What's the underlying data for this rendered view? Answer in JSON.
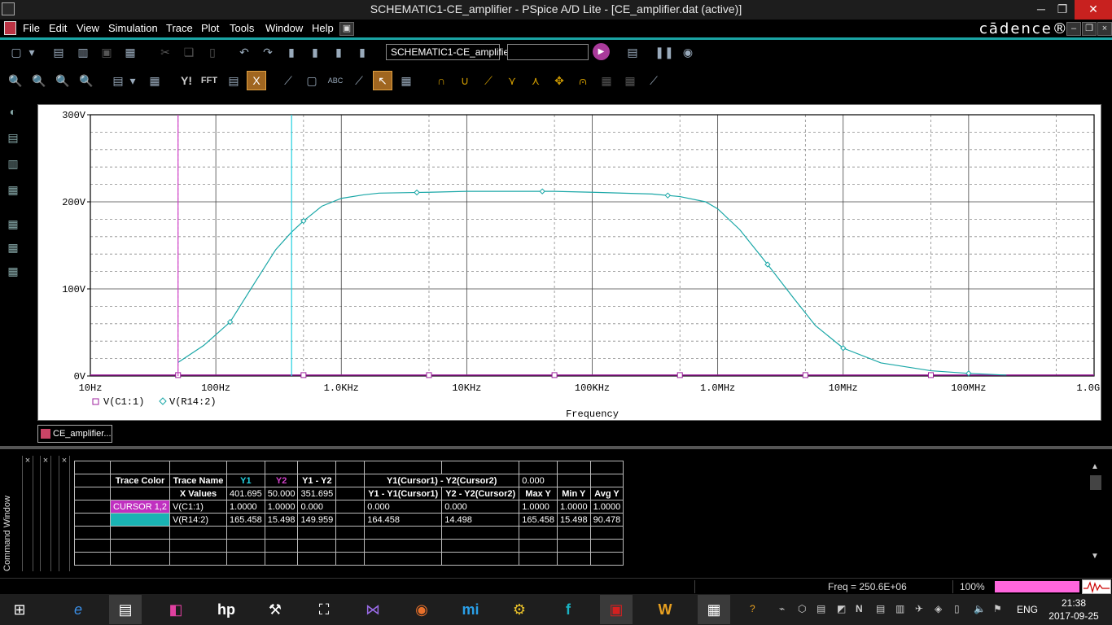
{
  "window": {
    "title": "SCHEMATIC1-CE_amplifier - PSpice A/D Lite - [CE_amplifier.dat (active)]",
    "minimize": "─",
    "restore": "❐",
    "close": "✕"
  },
  "menu": {
    "items": [
      "File",
      "Edit",
      "View",
      "Simulation",
      "Trace",
      "Plot",
      "Tools",
      "Window",
      "Help"
    ],
    "brand": "cādence®"
  },
  "toolbar": {
    "profile": "SCHEMATIC1-CE_amplifier",
    "fft_label": "FFT",
    "y_label": "Y!"
  },
  "plot": {
    "y_ticks": [
      "300V",
      "200V",
      "100V",
      "0V"
    ],
    "x_ticks": [
      "10Hz",
      "100Hz",
      "1.0KHz",
      "10KHz",
      "100KHz",
      "1.0MHz",
      "10MHz",
      "100MHz",
      "1.0GHz"
    ],
    "xlabel": "Frequency",
    "legend": [
      "V(C1:1)",
      "V(R14:2)"
    ],
    "colors": {
      "vr14": "#1aa7a7",
      "vc1": "#9c1f9c",
      "cursor1": "#22d0e0",
      "cursor2": "#d040c8",
      "grid": "#8a8a8a"
    }
  },
  "chart_data": {
    "type": "line",
    "xscale": "log",
    "xlim": [
      "10Hz",
      "1.0GHz"
    ],
    "ylim": [
      0,
      300
    ],
    "xlabel": "Frequency",
    "series": [
      {
        "name": "V(R14:2)",
        "x": [
          50,
          80,
          130,
          200,
          300,
          400,
          500,
          700,
          1000,
          1500,
          2000,
          5000,
          10000,
          50000,
          100000,
          300000,
          500000,
          800000,
          1000000,
          1500000,
          2500000,
          4000000,
          6000000,
          10000000,
          20000000,
          50000000,
          100000000,
          200000000
        ],
        "y": [
          15.5,
          35,
          62,
          105,
          145,
          165,
          178,
          195,
          204,
          208,
          210,
          211,
          212,
          212,
          211,
          209,
          206,
          200,
          192,
          168,
          128,
          90,
          58,
          32,
          15,
          6,
          3,
          1
        ]
      },
      {
        "name": "V(C1:1)",
        "x": [
          10,
          1000000000
        ],
        "y": [
          1,
          1
        ]
      }
    ],
    "cursors": {
      "Y1": 401.695,
      "Y2": 50.0
    }
  },
  "tab": {
    "label": "CE_amplifier...."
  },
  "cursor_table": {
    "header1": {
      "y1y2": "Y1(Cursor1) - Y2(Cursor2)",
      "value": "0.000"
    },
    "header2": [
      "Trace Color",
      "Trace Name",
      "Y1",
      "Y2",
      "Y1 - Y2"
    ],
    "row_x": [
      "X Values",
      "401.695",
      "50.000",
      "351.695",
      "Y1 - Y1(Cursor1)",
      "Y2 - Y2(Cursor2)",
      "Max Y",
      "Min Y",
      "Avg Y"
    ],
    "row1": [
      "CURSOR 1,2",
      "V(C1:1)",
      "1.0000",
      "1.0000",
      "0.000",
      "0.000",
      "0.000",
      "1.0000",
      "1.0000",
      "1.0000"
    ],
    "row2": [
      "V(R14:2)",
      "165.458",
      "15.498",
      "149.959",
      "164.458",
      "14.498",
      "165.458",
      "15.498",
      "90.478"
    ]
  },
  "command_window": "Command Window",
  "status": {
    "freq": "Freq =  250.6E+06",
    "zoom": "100%"
  },
  "taskbar": {
    "lang": "ENG",
    "time": "21:38",
    "date": "2017-09-25"
  }
}
